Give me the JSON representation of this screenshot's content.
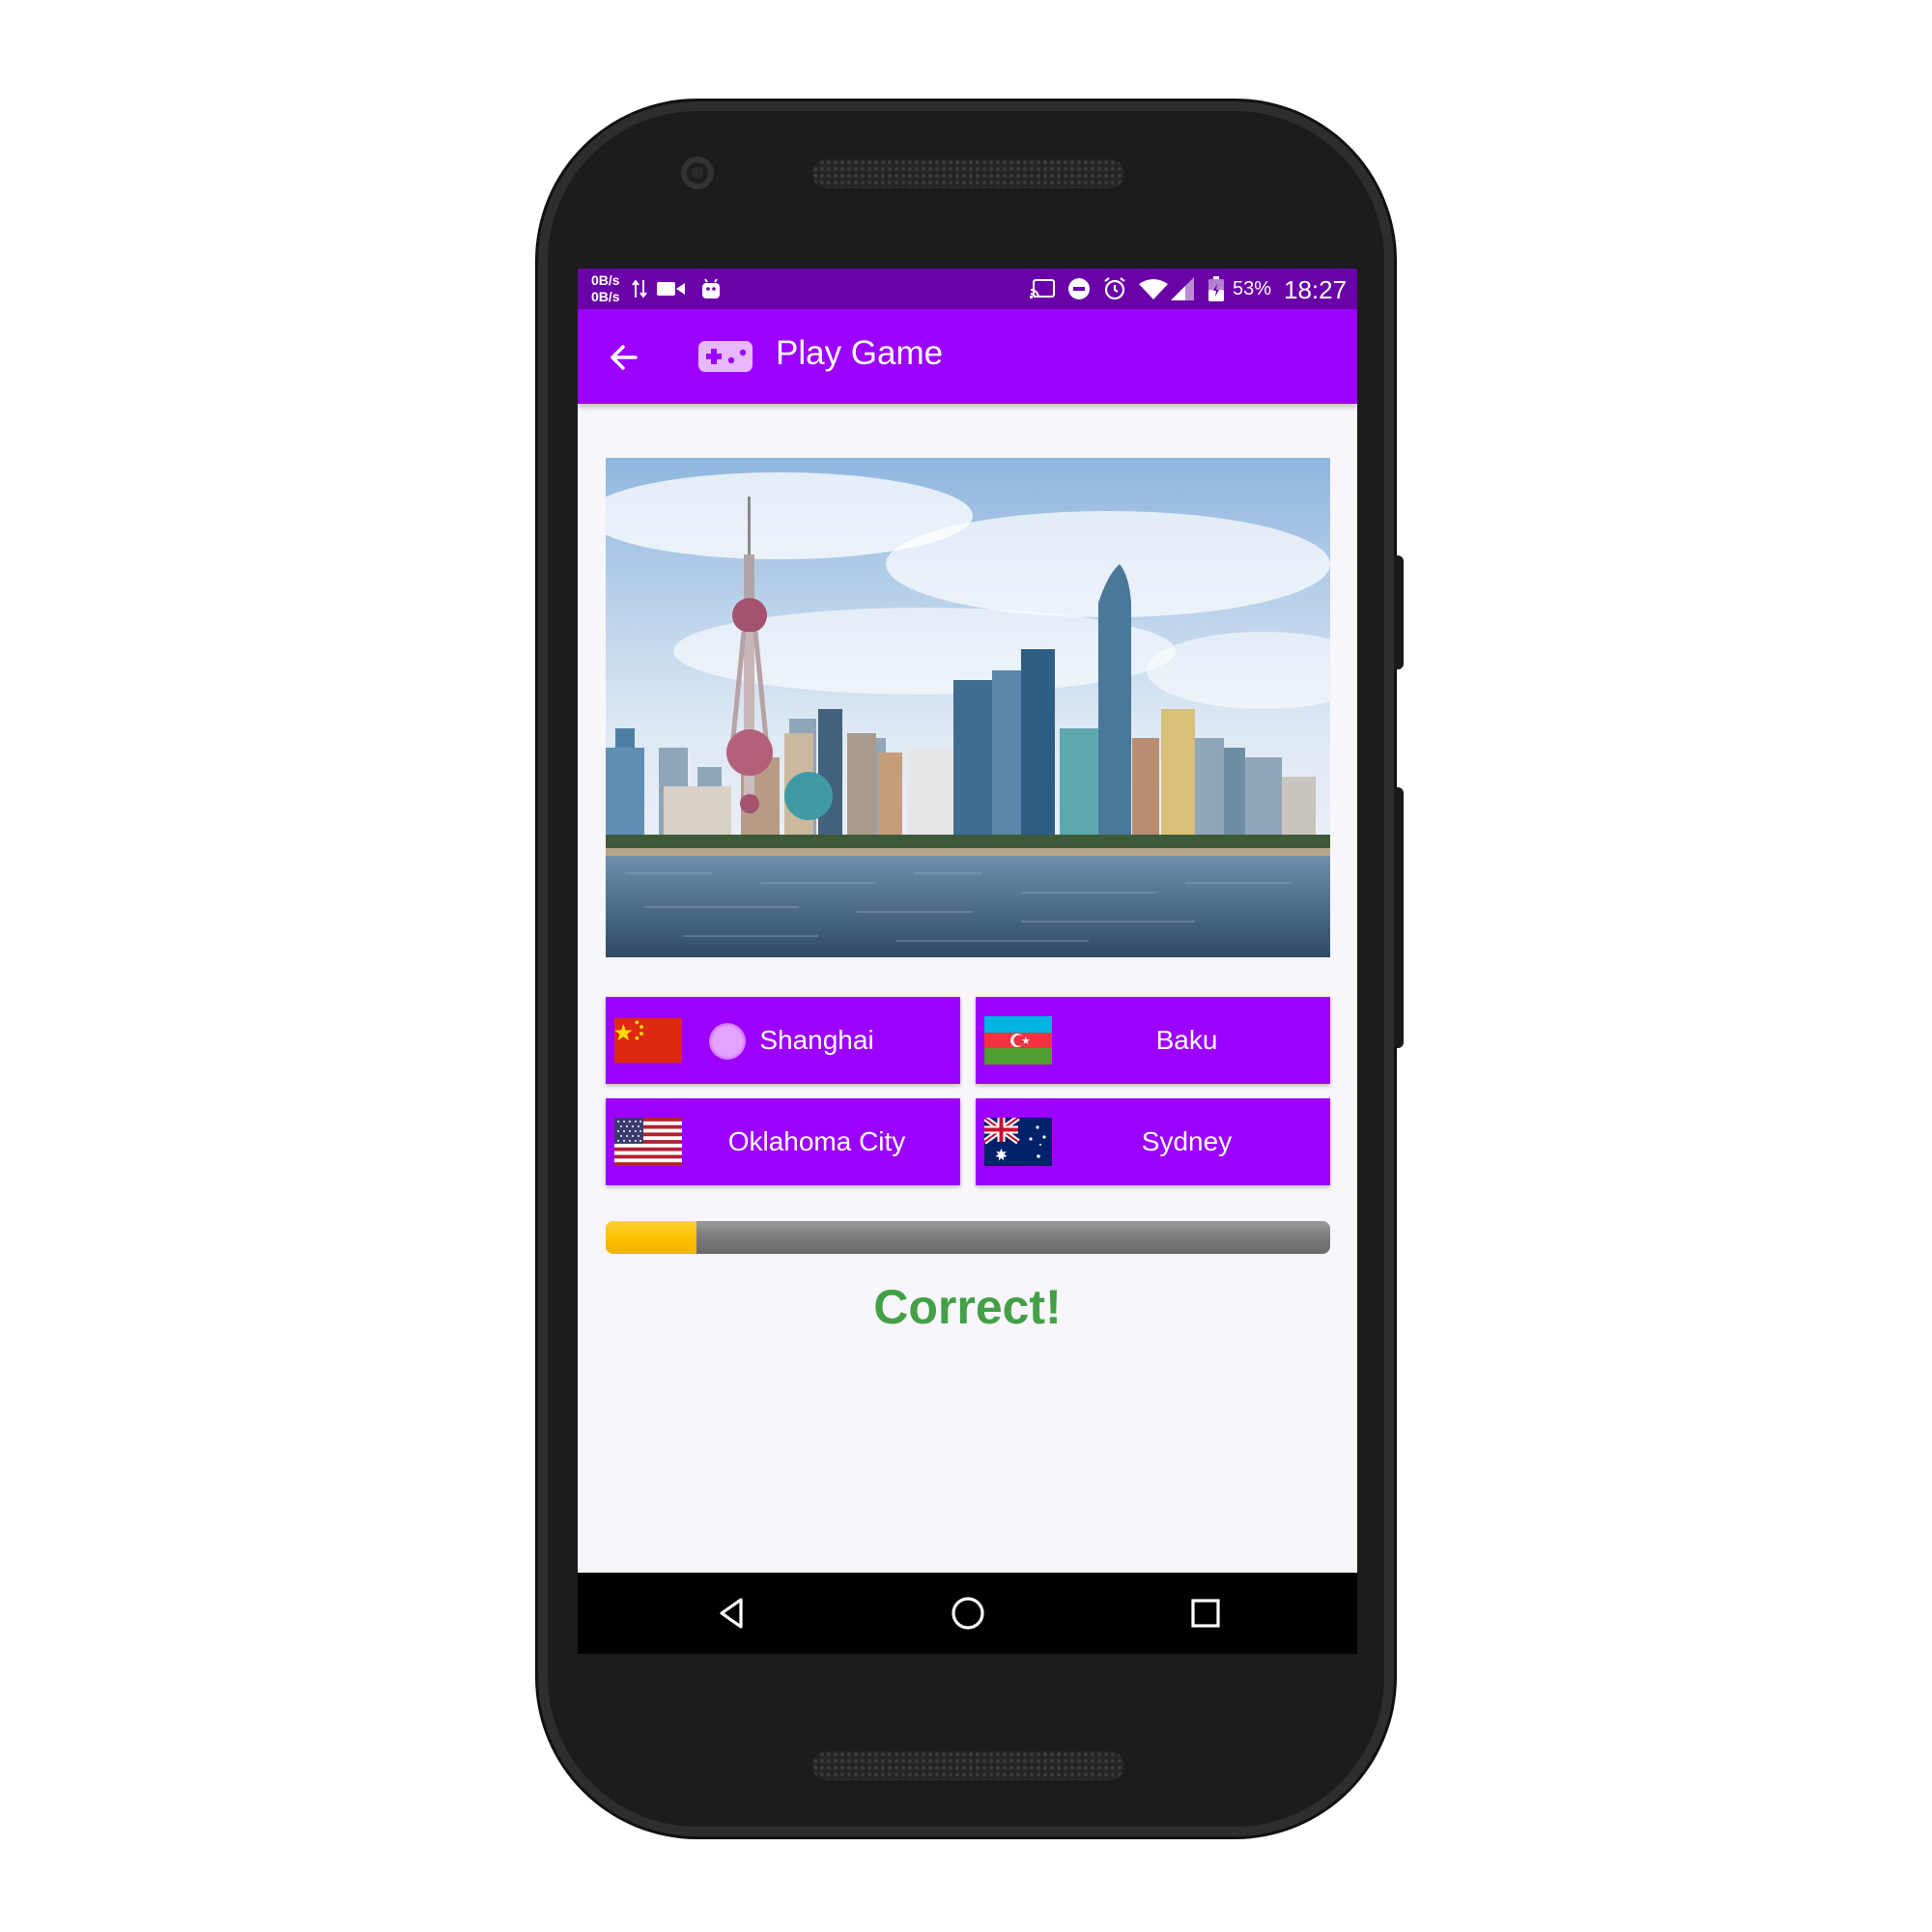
{
  "status_bar": {
    "net_up": "0B/s",
    "net_down": "0B/s",
    "battery": "53%",
    "time": "18:27",
    "icons": [
      "data-arrows-icon",
      "video-camera-icon",
      "android-icon",
      "cast-icon",
      "do-not-disturb-icon",
      "alarm-icon",
      "wifi-icon",
      "signal-icon",
      "battery-icon"
    ]
  },
  "app_bar": {
    "title": "Play Game",
    "back_icon": "arrow-back-icon",
    "logo_icon": "gamepad-icon",
    "color": "#9c00ff"
  },
  "question": {
    "image": "city-skyline-photo"
  },
  "answers": [
    {
      "label": "Shanghai",
      "flag": "china-flag-icon"
    },
    {
      "label": "Baku",
      "flag": "azerbaijan-flag-icon"
    },
    {
      "label": "Oklahoma City",
      "flag": "usa-flag-icon"
    },
    {
      "label": "Sydney",
      "flag": "australia-flag-icon"
    }
  ],
  "progress": {
    "value": 0.125,
    "fill_color": "#ffc000"
  },
  "result": {
    "text": "Correct!",
    "color": "#43a047"
  },
  "nav_bar": {
    "icons": [
      "nav-back-icon",
      "nav-home-icon",
      "nav-recents-icon"
    ]
  }
}
